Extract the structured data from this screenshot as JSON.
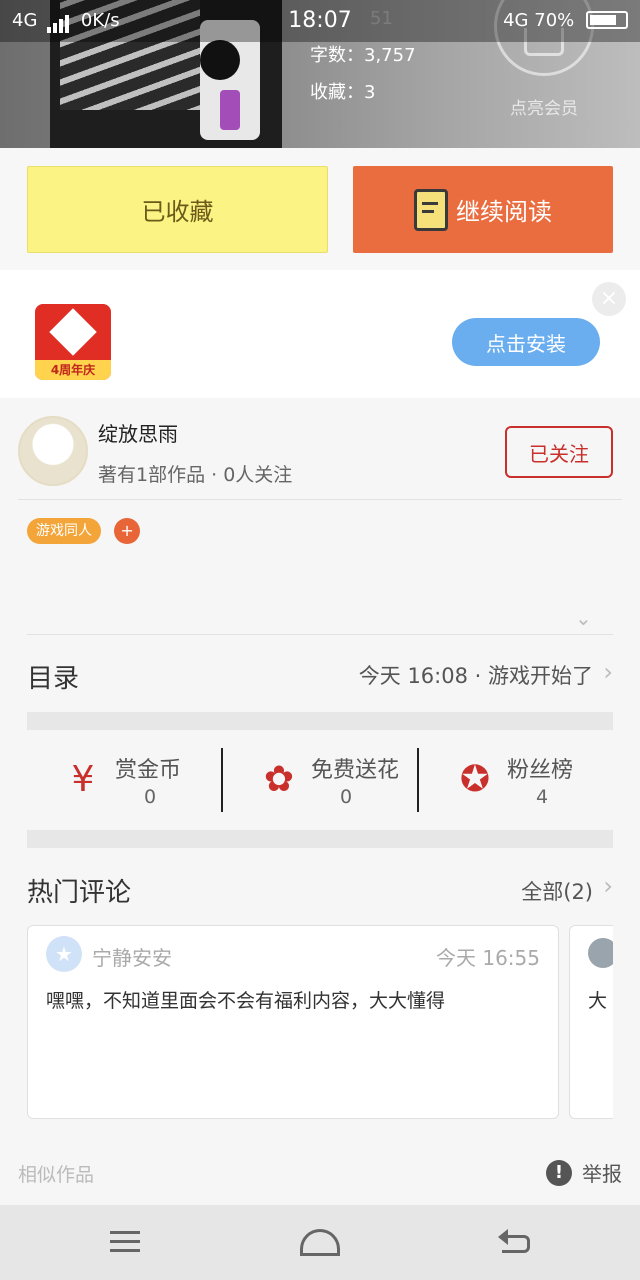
{
  "status_bar": {
    "network_left": "4G",
    "speed": "0K/s",
    "time": "18:07",
    "network_right": "4G",
    "battery": "70%"
  },
  "book": {
    "meta": [
      {
        "label": "字数：",
        "value": "3,757"
      },
      {
        "label": "收藏：",
        "value": "3"
      }
    ],
    "partial_top_value": "51",
    "vip_label": "点亮会员"
  },
  "actions": {
    "collected_label": "已收藏",
    "continue_label": "继续阅读"
  },
  "ad": {
    "app_badge": "4周年庆",
    "install_label": "点击安装",
    "close_label": "×"
  },
  "author": {
    "name": "绽放思雨",
    "summary": "著有1部作品 · 0人关注",
    "follow_label": "已关注"
  },
  "tags": {
    "items": [
      "游戏同人"
    ],
    "add_label": "+"
  },
  "catalog": {
    "title": "目录",
    "latest": "今天 16:08 · 游戏开始了"
  },
  "stats": [
    {
      "label": "赏金币",
      "value": "0",
      "icon": "reward-coin-icon"
    },
    {
      "label": "免费送花",
      "value": "0",
      "icon": "flower-icon"
    },
    {
      "label": "粉丝榜",
      "value": "4",
      "icon": "fan-ranking-icon"
    }
  ],
  "comments": {
    "title": "热门评论",
    "all_label": "全部(2)",
    "items": [
      {
        "user": "宁静安安",
        "time": "今天 16:55",
        "text": "嘿嘿，不知道里面会不会有福利内容，大大懂得"
      },
      {
        "text": "大"
      }
    ]
  },
  "footer": {
    "similar_label": "相似作品",
    "report_label": "举报",
    "report_icon": "!"
  }
}
